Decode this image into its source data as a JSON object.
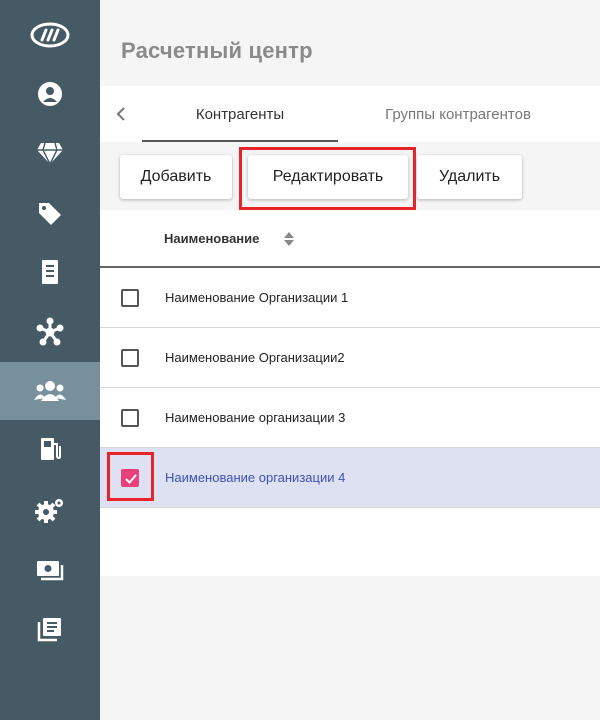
{
  "app": {
    "title": "Расчетный центр"
  },
  "sidebar": {
    "items": [
      {
        "icon": "logo-icon",
        "active": false
      },
      {
        "icon": "user-icon",
        "active": false
      },
      {
        "icon": "diamond-icon",
        "active": false
      },
      {
        "icon": "tags-icon",
        "active": false
      },
      {
        "icon": "receipt-icon",
        "active": false
      },
      {
        "icon": "network-icon",
        "active": false
      },
      {
        "icon": "users-icon",
        "active": true
      },
      {
        "icon": "fuel-pump-icon",
        "active": false
      },
      {
        "icon": "gears-icon",
        "active": false
      },
      {
        "icon": "cash-icon",
        "active": false
      },
      {
        "icon": "ledger-icon",
        "active": false
      }
    ]
  },
  "tabs": {
    "back_icon": "chevron-left-icon",
    "items": [
      {
        "label": "Контрагенты",
        "active": true
      },
      {
        "label": "Группы контрагентов",
        "active": false
      }
    ]
  },
  "toolbar": {
    "add_label": "Добавить",
    "edit_label": "Редактировать",
    "delete_label": "Удалить"
  },
  "table": {
    "column_name": "Наименование",
    "sort_icon": "sort-icon",
    "rows": [
      {
        "name": "Наименование Организации 1",
        "checked": false
      },
      {
        "name": "Наименование Организации2",
        "checked": false
      },
      {
        "name": "Наименование организации 3",
        "checked": false
      },
      {
        "name": "Наименование организации 4",
        "checked": true
      }
    ]
  },
  "colors": {
    "sidebar": "#455a64",
    "sidebar_active": "#78909c",
    "accent_pink": "#ec407a",
    "highlight_red": "#e8232a",
    "selected_row": "#dde1f1",
    "selected_text": "#3f51b5"
  }
}
